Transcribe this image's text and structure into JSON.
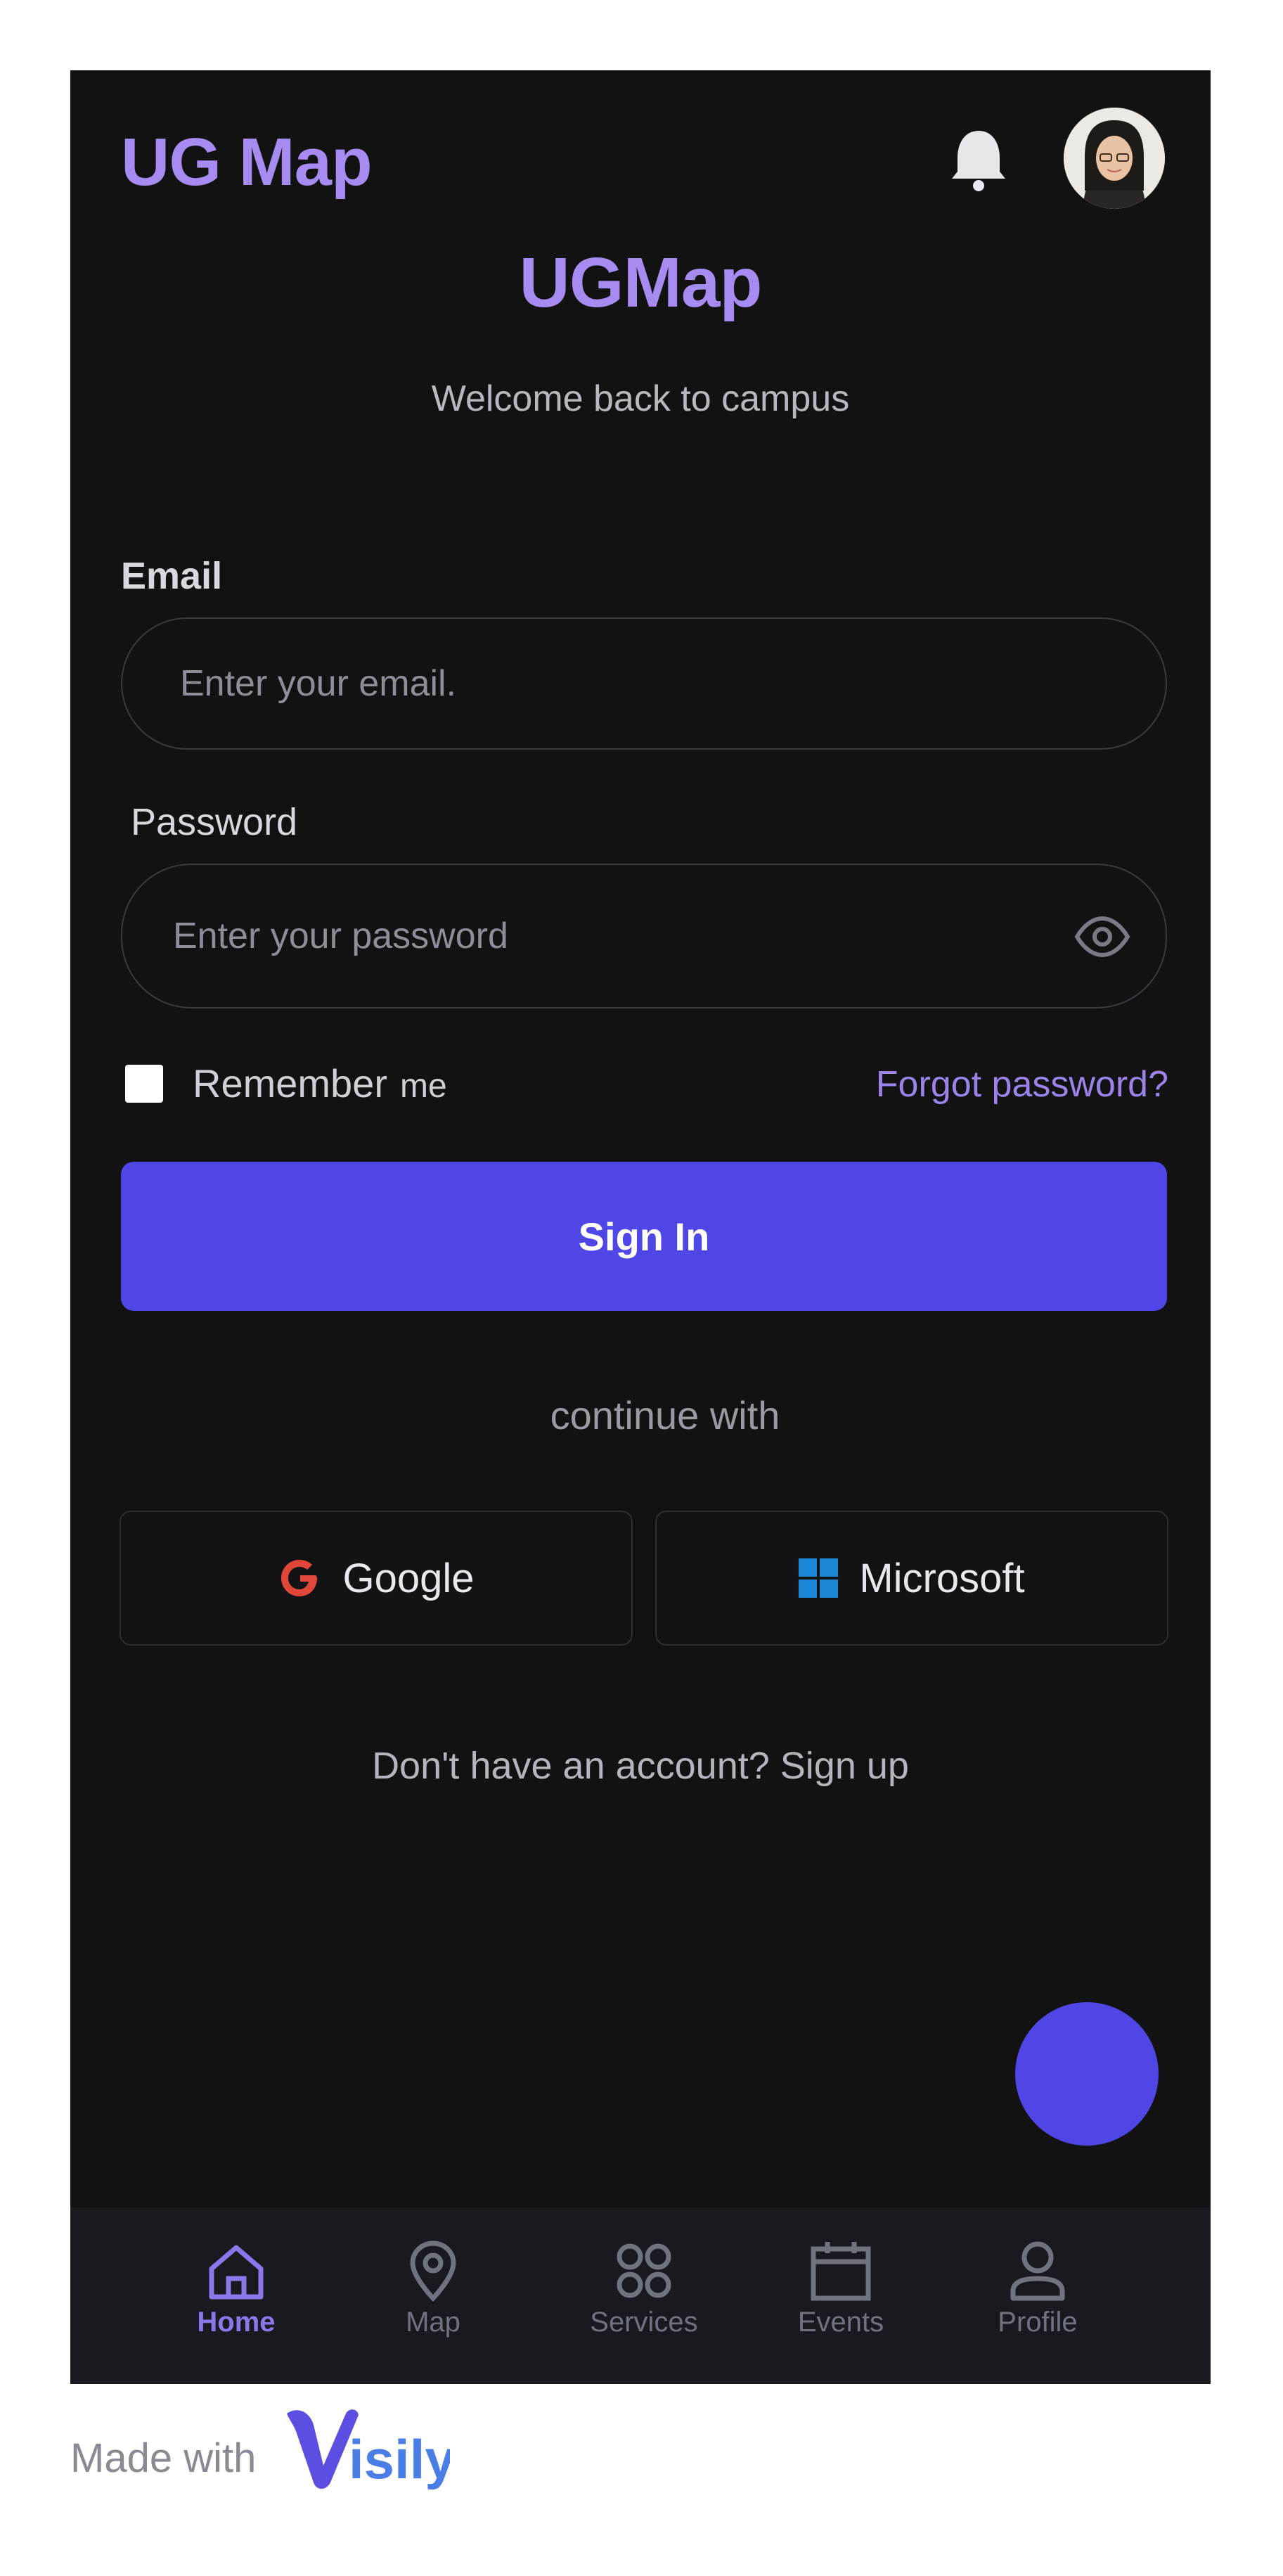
{
  "header": {
    "app_title": "UG Map"
  },
  "login": {
    "brand": "UGMap",
    "subtitle": "Welcome back to campus",
    "email_label": "Email",
    "email_placeholder": "Enter your email.",
    "password_label": "Password",
    "password_placeholder": "Enter your password",
    "remember_label": "Remember",
    "remember_suffix": "me",
    "forgot_link": "Forgot password?",
    "signin_label": "Sign In",
    "continue_text": "continue with",
    "google_label": "Google",
    "microsoft_label": "Microsoft",
    "signup_text": "Don't have an account? Sign up"
  },
  "nav": {
    "items": [
      {
        "label": "Home",
        "icon": "home-icon",
        "active": true
      },
      {
        "label": "Map",
        "icon": "map-pin-icon",
        "active": false
      },
      {
        "label": "Services",
        "icon": "grid-circles-icon",
        "active": false
      },
      {
        "label": "Events",
        "icon": "calendar-icon",
        "active": false
      },
      {
        "label": "Profile",
        "icon": "user-icon",
        "active": false
      }
    ]
  },
  "footer": {
    "made_with": "Made with",
    "logo_text": "Visily"
  },
  "colors": {
    "accent": "#a68bf0",
    "primary_button": "#4f46e5",
    "background": "#121213",
    "nav_background": "#181a20",
    "link": "#9b83ea"
  }
}
